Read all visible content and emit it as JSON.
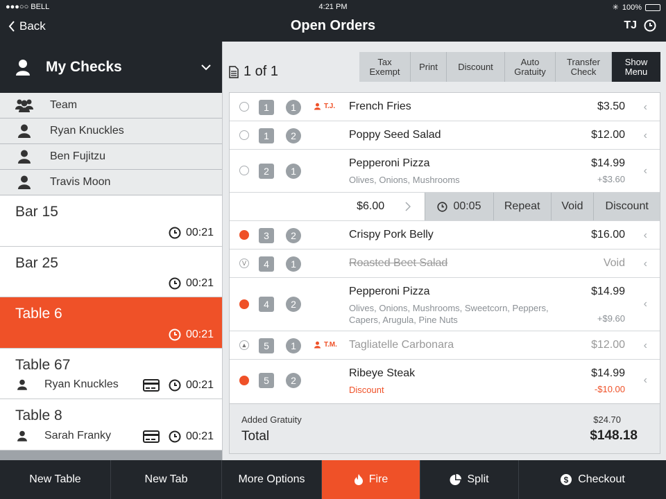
{
  "status": {
    "carrier": "●●●○○ BELL",
    "time": "4:21 PM",
    "battery": "100%"
  },
  "nav": {
    "back": "Back",
    "title": "Open Orders",
    "user": "TJ"
  },
  "my_checks": {
    "label": "My Checks"
  },
  "staff": [
    {
      "name": "Team",
      "icon": "team-icon"
    },
    {
      "name": "Ryan Knuckles",
      "icon": "person-icon"
    },
    {
      "name": "Ben Fujitzu",
      "icon": "person-icon"
    },
    {
      "name": "Travis Moon",
      "icon": "person-icon"
    }
  ],
  "tickets": [
    {
      "name": "Bar 15",
      "time": "00:21"
    },
    {
      "name": "Bar 25",
      "time": "00:21"
    },
    {
      "name": "Table 6",
      "time": "00:21"
    },
    {
      "name": "Table 67",
      "time": "00:21",
      "owner": "Ryan Knuckles"
    },
    {
      "name": "Table 8",
      "time": "00:21",
      "owner": "Sarah Franky"
    }
  ],
  "check": {
    "page": "1 of 1"
  },
  "toolbar": {
    "tax_exempt_1": "Tax",
    "tax_exempt_2": "Exempt",
    "print": "Print",
    "discount": "Discount",
    "auto_gratuity_1": "Auto",
    "auto_gratuity_2": "Gratuity",
    "transfer_1": "Transfer",
    "transfer_2": "Check",
    "show_menu_1": "Show",
    "show_menu_2": "Menu"
  },
  "orders": [
    {
      "seat": "1",
      "course": "1",
      "owner": "T.J.",
      "item": "French Fries",
      "price": "$3.50",
      "state": "open"
    },
    {
      "seat": "1",
      "course": "2",
      "item": "Poppy Seed Salad",
      "price": "$12.00",
      "state": "open"
    },
    {
      "seat": "2",
      "course": "1",
      "item": "Pepperoni Pizza",
      "mods": "Olives, Onions, Mushrooms",
      "price": "$14.99",
      "subprice": "+$3.60",
      "state": "open"
    },
    {
      "seat": "3",
      "course": "2",
      "item": "Crispy Pork Belly",
      "price": "$16.00",
      "state": "fired"
    },
    {
      "seat": "4",
      "course": "1",
      "item": "Roasted Beet Salad",
      "price": "Void",
      "state": "voided",
      "mark": "V"
    },
    {
      "seat": "4",
      "course": "2",
      "item": "Pepperoni Pizza",
      "mods": "Olives, Onions, Mushrooms, Sweetcorn, Peppers, Capers, Arugula, Pine Nuts",
      "price": "$14.99",
      "subprice": "+$9.60",
      "state": "fired"
    },
    {
      "seat": "5",
      "course": "1",
      "owner": "T.M.",
      "item": "Tagliatelle Carbonara",
      "price": "$12.00",
      "state": "held"
    },
    {
      "seat": "5",
      "course": "2",
      "item": "Ribeye Steak",
      "mods": "Discount",
      "price": "$14.99",
      "subprice": "-$10.00",
      "state": "fired"
    }
  ],
  "action": {
    "amount": "$6.00",
    "timer": "00:05",
    "repeat": "Repeat",
    "void": "Void",
    "discount": "Discount"
  },
  "totals": {
    "gratuity_label": "Added Gratuity",
    "gratuity_value": "$24.70",
    "total_label": "Total",
    "total_value": "$148.18"
  },
  "bottom": {
    "new_table": "New Table",
    "new_tab": "New Tab",
    "more_options": "More Options",
    "fire": "Fire",
    "split": "Split",
    "checkout": "Checkout"
  },
  "colors": {
    "accent": "#ef5128",
    "dark": "#22262b",
    "panel": "#e8eaec"
  }
}
